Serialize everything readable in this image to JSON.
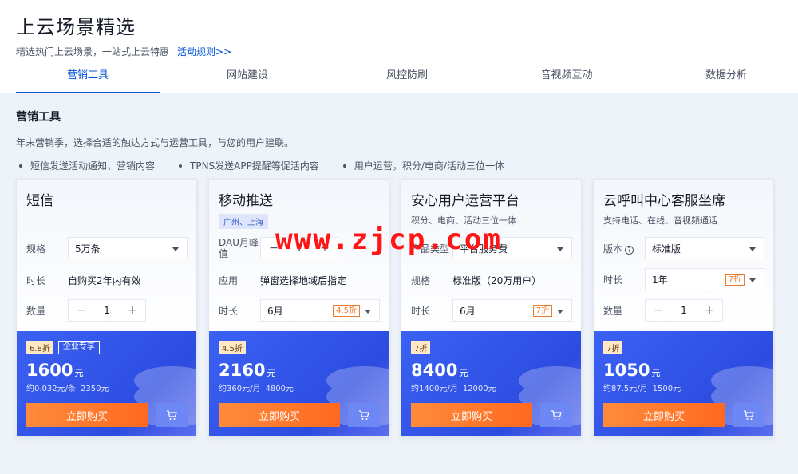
{
  "header": {
    "title": "上云场景精选",
    "subtitle": "精选热门上云场景，一站式上云特惠",
    "rules_link": "活动规则>>"
  },
  "tabs": [
    {
      "label": "营销工具",
      "active": true
    },
    {
      "label": "网站建设"
    },
    {
      "label": "风控防刷"
    },
    {
      "label": "音视频互动"
    },
    {
      "label": "数据分析"
    }
  ],
  "section": {
    "title": "营销工具",
    "desc": "年末营销季，选择合适的触达方式与运营工具，与您的用户建联。",
    "bullets": [
      "短信发送活动通知、营销内容",
      "TPNS发送APP提醒等促活内容",
      "用户运营，积分/电商/活动三位一体"
    ]
  },
  "cards": [
    {
      "title": "短信",
      "rows": [
        {
          "label": "规格",
          "value": "5万条"
        },
        {
          "label": "时长",
          "value": "自购买2年内有效"
        },
        {
          "label": "数量",
          "value": "1"
        }
      ],
      "discount": "6.8折",
      "enterprise_tag": "企业专享",
      "price": "1600",
      "unit": "元",
      "per_unit": "约0.032元/条",
      "orig_price": "2350元",
      "buy_label": "立即购买"
    },
    {
      "title": "移动推送",
      "region": "广州、上海",
      "rows": [
        {
          "label": "DAU月峰值",
          "value": "1"
        },
        {
          "label": "应用",
          "value": "弹窗选择地域后指定"
        },
        {
          "label": "时长",
          "value": "6月",
          "discount": "4.5折"
        }
      ],
      "discount": "4.5折",
      "price": "2160",
      "unit": "元",
      "per_unit": "约360元/月",
      "orig_price": "4800元",
      "buy_label": "立即购买"
    },
    {
      "title": "安心用户运营平台",
      "subtitle": "积分、电商、活动三位一体",
      "rows": [
        {
          "label": "产品类型",
          "value": "平台服务费"
        },
        {
          "label": "规格",
          "value": "标准版（20万用户）"
        },
        {
          "label": "时长",
          "value": "6月",
          "discount": "7折"
        }
      ],
      "discount": "7折",
      "price": "8400",
      "unit": "元",
      "per_unit": "约1400元/月",
      "orig_price": "12000元",
      "buy_label": "立即购买"
    },
    {
      "title": "云呼叫中心客服坐席",
      "subtitle": "支持电话、在线、音视频通话",
      "rows": [
        {
          "label": "版本",
          "value": "标准版"
        },
        {
          "label": "时长",
          "value": "1年",
          "discount": "7折"
        },
        {
          "label": "数量",
          "value": "1"
        }
      ],
      "discount": "7折",
      "price": "1050",
      "unit": "元",
      "per_unit": "约87.5元/月",
      "orig_price": "1500元",
      "buy_label": "立即购买"
    }
  ],
  "watermark": "www.zjcp.com",
  "colors": {
    "accent": "#0052d9",
    "card_bottom": "#3355ee",
    "buy": "#ff7a2e"
  }
}
